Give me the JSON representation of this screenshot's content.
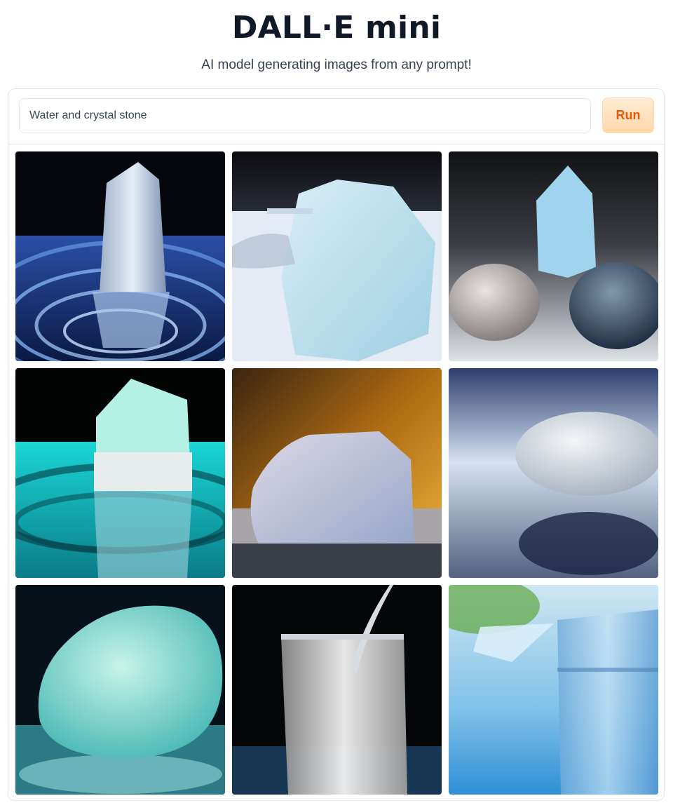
{
  "header": {
    "title": "DALL·E mini",
    "subtitle": "AI model generating images from any prompt!"
  },
  "prompt": {
    "value": "Water and crystal stone",
    "run_label": "Run"
  },
  "colors": {
    "accent": "#ea580c",
    "button_bg": "#fed7aa",
    "border": "#e5e7eb"
  },
  "gallery": {
    "items": [
      {
        "subject": "crystal-in-water-ripples"
      },
      {
        "subject": "ice-stone-with-splash"
      },
      {
        "subject": "crystal-with-pebbles"
      },
      {
        "subject": "crystal-on-turquoise-water"
      },
      {
        "subject": "ice-rock-on-water"
      },
      {
        "subject": "white-pebble-reflection"
      },
      {
        "subject": "turquoise-stone"
      },
      {
        "subject": "sparkling-water-glass"
      },
      {
        "subject": "glass-with-crystal"
      }
    ]
  }
}
